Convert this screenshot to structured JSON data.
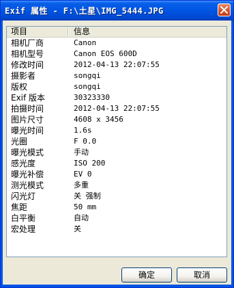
{
  "window": {
    "title": "Exif 属性 - F:\\土星\\IMG_5444.JPG"
  },
  "icons": {
    "close": "close-icon"
  },
  "colors": {
    "titlebar": "#0054e3",
    "close_button": "#d7572f",
    "dialog_background": "#ece9d8"
  },
  "list": {
    "columns": [
      "项目",
      "信息"
    ],
    "rows": [
      {
        "name": "相机厂商",
        "value": "Canon"
      },
      {
        "name": "相机型号",
        "value": "Canon EOS 600D"
      },
      {
        "name": "修改时间",
        "value": "2012-04-13 22:07:55"
      },
      {
        "name": "摄影者",
        "value": "songqi"
      },
      {
        "name": "版权",
        "value": "songqi"
      },
      {
        "name": "Exif 版本",
        "value": "30323330"
      },
      {
        "name": "拍摄时间",
        "value": "2012-04-13 22:07:55"
      },
      {
        "name": "图片尺寸",
        "value": "4608 x 3456"
      },
      {
        "name": "曝光时间",
        "value": "1.6s"
      },
      {
        "name": "光圈",
        "value": "F 0.0"
      },
      {
        "name": "曝光模式",
        "value": "手动"
      },
      {
        "name": "感光度",
        "value": "ISO 200"
      },
      {
        "name": "曝光补偿",
        "value": "EV 0"
      },
      {
        "name": "测光模式",
        "value": "多重"
      },
      {
        "name": "闪光灯",
        "value": "关 强制"
      },
      {
        "name": "焦距",
        "value": "50 mm"
      },
      {
        "name": "白平衡",
        "value": "自动"
      },
      {
        "name": "宏处理",
        "value": "关"
      }
    ]
  },
  "buttons": {
    "ok_label": "确定",
    "cancel_label": "取消"
  }
}
